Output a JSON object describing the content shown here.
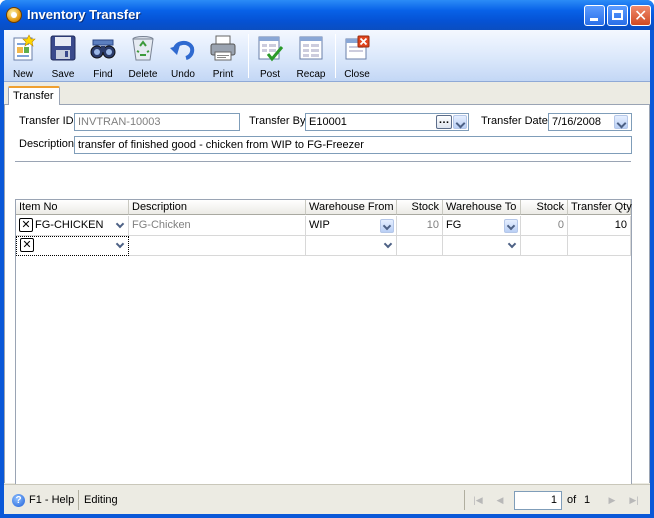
{
  "window": {
    "title": "Inventory Transfer"
  },
  "toolbar": {
    "items": [
      {
        "label": "New",
        "icon": "new-doc-icon"
      },
      {
        "label": "Save",
        "icon": "floppy-icon"
      },
      {
        "label": "Find",
        "icon": "binoculars-icon"
      },
      {
        "label": "Delete",
        "icon": "recycle-bin-icon"
      },
      {
        "label": "Undo",
        "icon": "undo-arrow-icon"
      },
      {
        "label": "Print",
        "icon": "printer-icon"
      },
      {
        "label": "Post",
        "icon": "post-check-icon"
      },
      {
        "label": "Recap",
        "icon": "recap-grid-icon"
      },
      {
        "label": "Close",
        "icon": "close-window-icon"
      }
    ]
  },
  "tabs": [
    {
      "label": "Transfer",
      "active": true
    }
  ],
  "form": {
    "transfer_id_label": "Transfer ID",
    "transfer_id_value": "INVTRAN-10003",
    "transfer_by_label": "Transfer By",
    "transfer_by_value": "E10001",
    "transfer_date_label": "Transfer Date",
    "transfer_date_value": "7/16/2008",
    "description_label": "Description",
    "description_value": "transfer of finished good - chicken from WIP to FG-Freezer"
  },
  "grid": {
    "columns": [
      "Item No",
      "Description",
      "Warehouse From",
      "Stock",
      "Warehouse To",
      "Stock",
      "Transfer Qty"
    ],
    "rows": [
      {
        "item_no": "FG-CHICKEN",
        "description": "FG-Chicken",
        "warehouse_from": "WIP",
        "stock_from": "10",
        "warehouse_to": "FG",
        "stock_to": "0",
        "transfer_qty": "10"
      },
      {
        "item_no": "",
        "description": "",
        "warehouse_from": "",
        "stock_from": "",
        "warehouse_to": "",
        "stock_to": "",
        "transfer_qty": ""
      }
    ]
  },
  "statusbar": {
    "help": "F1 - Help",
    "status": "Editing",
    "page": "1",
    "of_label": "of",
    "total_pages": "1"
  },
  "colors": {
    "titlebar": "#0552d4",
    "tab_accent": "#f0a030",
    "client_bg": "#ecebe3"
  }
}
